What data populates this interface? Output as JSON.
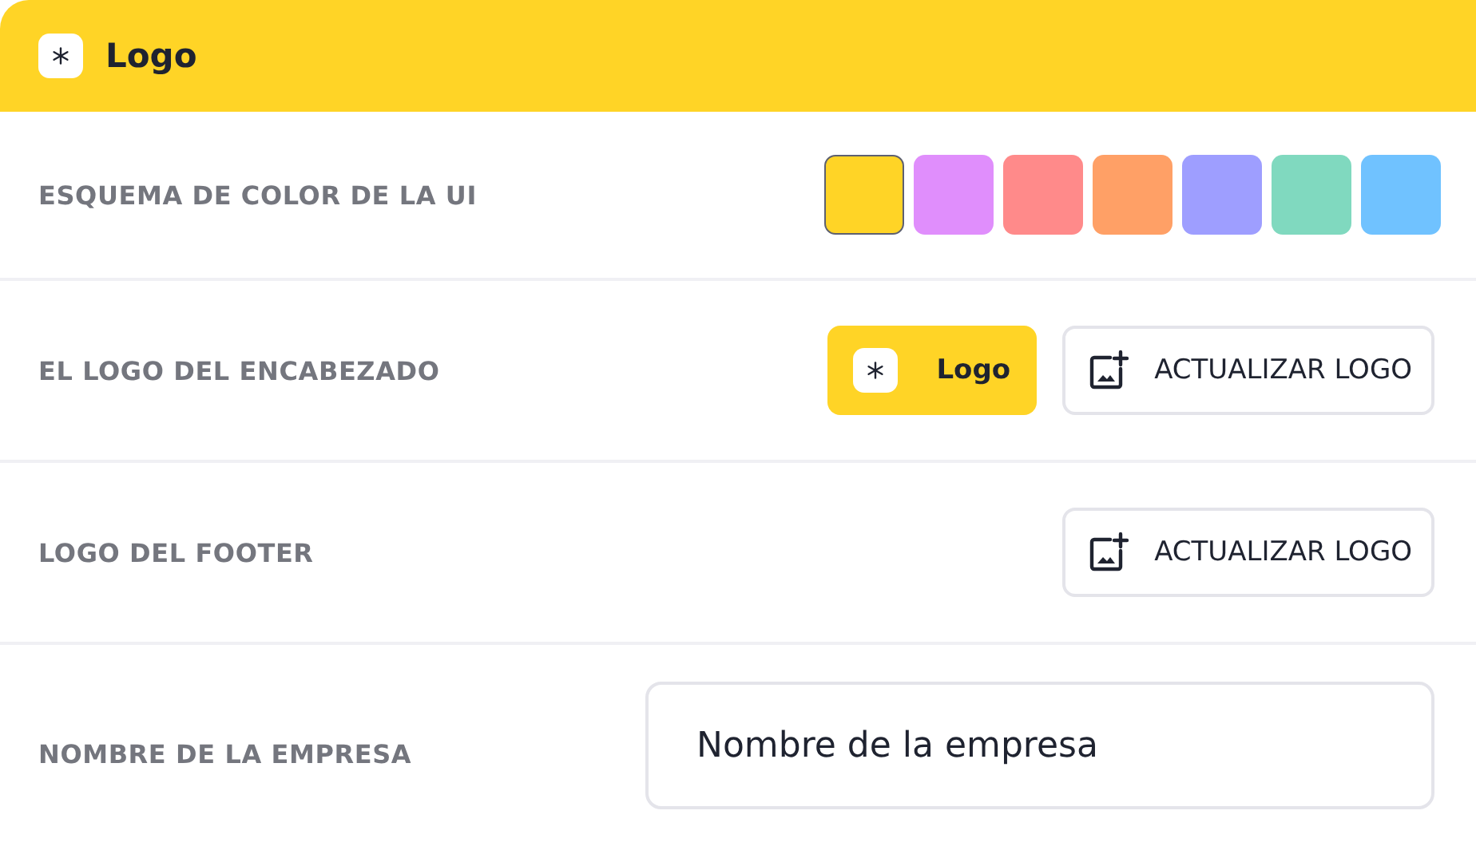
{
  "header": {
    "title": "Logo"
  },
  "rows": [
    {
      "kind": "colors",
      "label": "ESQUEMA DE COLOR DE LA UI",
      "colors": [
        {
          "color": "#ffd426",
          "selected": true
        },
        {
          "color": "#e08efc",
          "selected": false
        },
        {
          "color": "#ff8a8a",
          "selected": false
        },
        {
          "color": "#ffa066",
          "selected": false
        },
        {
          "color": "#9e9eff",
          "selected": false
        },
        {
          "color": "#80d9bf",
          "selected": false
        },
        {
          "color": "#70c2ff",
          "selected": false
        }
      ]
    },
    {
      "kind": "logo",
      "label": "EL LOGO DEL ENCABEZADO",
      "preview": "Logo",
      "button": "ACTUALIZAR LOGO"
    },
    {
      "kind": "logo",
      "label": "LOGO DEL FOOTER",
      "button": "ACTUALIZAR LOGO"
    },
    {
      "kind": "input",
      "label": "NOMBRE DE LA EMPRESA",
      "value": "Nombre de la empresa"
    }
  ]
}
